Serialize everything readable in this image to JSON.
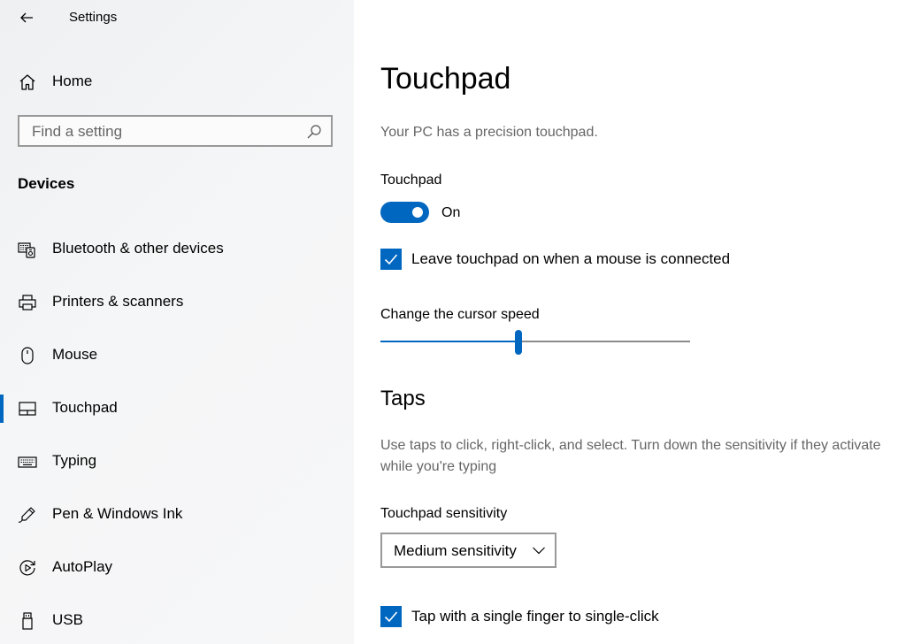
{
  "window": {
    "title": "Settings",
    "back_icon": "back-arrow-icon"
  },
  "sidebar": {
    "home": {
      "label": "Home",
      "icon": "home-icon"
    },
    "search": {
      "placeholder": "Find a setting",
      "value": "",
      "icon": "search-icon"
    },
    "section_header": "Devices",
    "items": [
      {
        "label": "Bluetooth & other devices",
        "icon": "bluetooth-devices-icon",
        "selected": false
      },
      {
        "label": "Printers & scanners",
        "icon": "printer-icon",
        "selected": false
      },
      {
        "label": "Mouse",
        "icon": "mouse-icon",
        "selected": false
      },
      {
        "label": "Touchpad",
        "icon": "touchpad-icon",
        "selected": true
      },
      {
        "label": "Typing",
        "icon": "keyboard-icon",
        "selected": false
      },
      {
        "label": "Pen & Windows Ink",
        "icon": "pen-icon",
        "selected": false
      },
      {
        "label": "AutoPlay",
        "icon": "autoplay-icon",
        "selected": false
      },
      {
        "label": "USB",
        "icon": "usb-icon",
        "selected": false
      }
    ]
  },
  "main": {
    "title": "Touchpad",
    "subtitle": "Your PC has a precision touchpad.",
    "touchpad_toggle": {
      "label": "Touchpad",
      "state_label": "On",
      "on": true
    },
    "leave_on_checkbox": {
      "label": "Leave touchpad on when a mouse is connected",
      "checked": true
    },
    "cursor_speed": {
      "label": "Change the cursor speed",
      "value_fraction": 0.445
    },
    "taps": {
      "title": "Taps",
      "description": "Use taps to click, right-click, and select. Turn down the sensitivity if they activate while you're typing",
      "sensitivity": {
        "label": "Touchpad sensitivity",
        "selected": "Medium sensitivity"
      },
      "single_tap_checkbox": {
        "label": "Tap with a single finger to single-click",
        "checked": true
      }
    }
  },
  "colors": {
    "accent": "#0067c0",
    "secondary_text": "#666666",
    "sidebar_bg": "#f3f4f5"
  }
}
